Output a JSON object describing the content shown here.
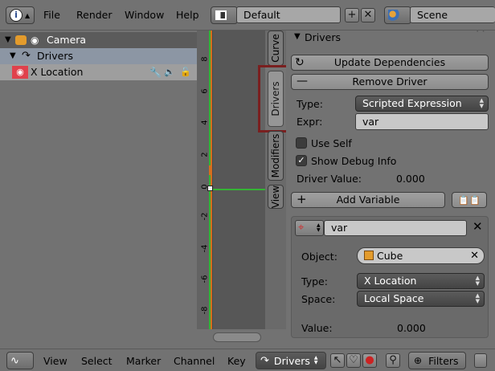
{
  "header": {
    "menus": [
      "File",
      "Render",
      "Window",
      "Help"
    ],
    "layout_value": "Default",
    "scene_value": "Scene"
  },
  "channels": {
    "camera_label": "Camera",
    "drivers_label": "Drivers",
    "x_location_label": "X Location"
  },
  "graph": {
    "ticks": [
      "8",
      "6",
      "4",
      "2",
      "0",
      "-2",
      "-4",
      "-6",
      "-8"
    ]
  },
  "tabs": {
    "curve": "Curve",
    "drivers": "Drivers",
    "modifiers": "Modifiers",
    "view": "View"
  },
  "panel": {
    "title": "Drivers",
    "update_dependencies": "Update Dependencies",
    "remove_driver": "Remove Driver",
    "type_label": "Type:",
    "type_value": "Scripted Expression",
    "expr_label": "Expr:",
    "expr_value": "var",
    "use_self": "Use Self",
    "show_debug_info": "Show Debug Info",
    "driver_value_label": "Driver Value:",
    "driver_value": "0.000",
    "add_variable": "Add Variable",
    "var_name": "var",
    "object_label": "Object:",
    "object_value": "Cube",
    "var_type_label": "Type:",
    "var_type_value": "X Location",
    "space_label": "Space:",
    "space_value": "Local Space",
    "value_label": "Value:",
    "value_value": "0.000"
  },
  "bottom": {
    "menus": [
      "View",
      "Select",
      "Marker",
      "Channel",
      "Key"
    ],
    "mode_value": "Drivers",
    "filters_label": "Filters"
  },
  "colors": {
    "highlight_box": "#7a1f1f",
    "curve_green": "#35b335",
    "playhead_orange": "#d66e1e"
  }
}
